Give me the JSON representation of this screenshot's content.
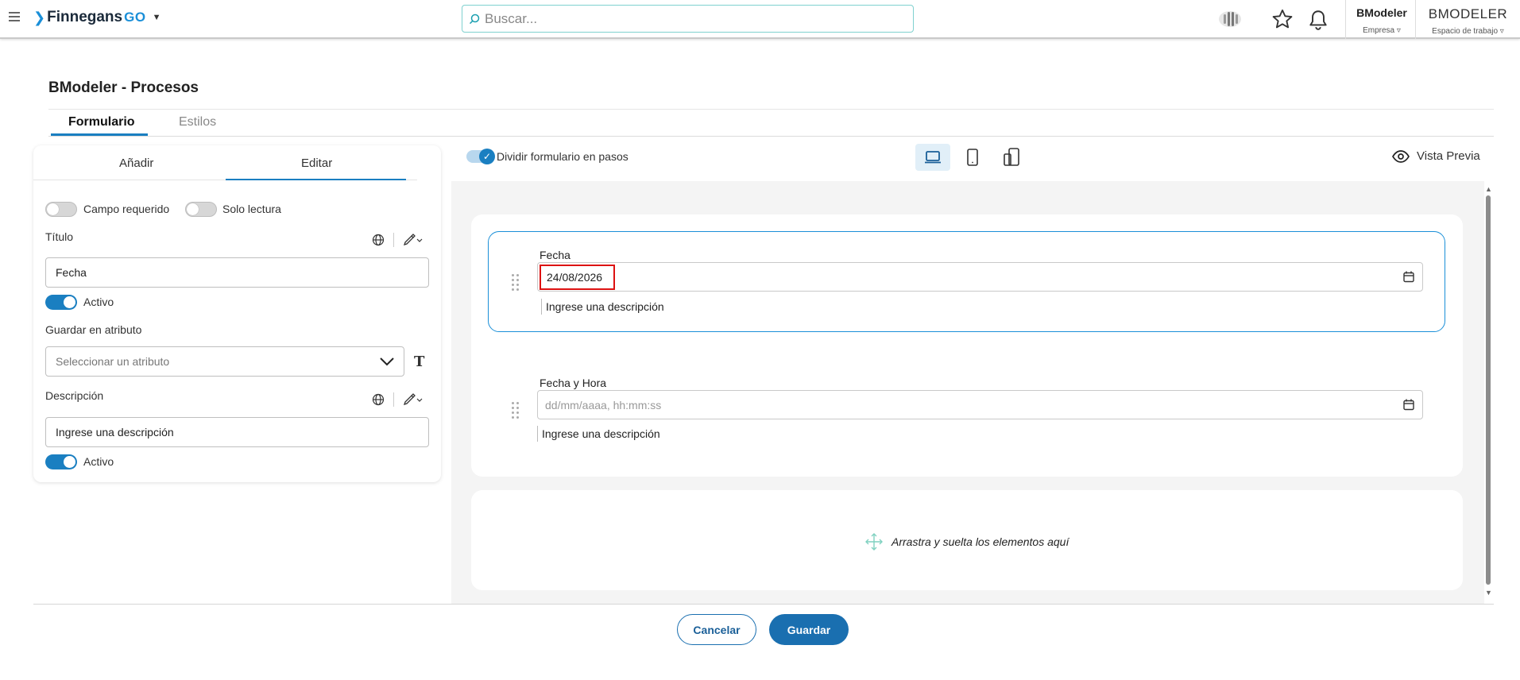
{
  "brand": {
    "name": "Finnegans",
    "suffix": "GO"
  },
  "search": {
    "placeholder": "Buscar..."
  },
  "user_menu": {
    "company_name": "BModeler",
    "company_label": "Empresa",
    "workspace_name": "BMODELER",
    "workspace_label": "Espacio de trabajo"
  },
  "page": {
    "title": "BModeler - Procesos"
  },
  "main_tabs": [
    {
      "label": "Formulario",
      "active": true
    },
    {
      "label": "Estilos",
      "active": false
    }
  ],
  "left_panel": {
    "tabs": [
      {
        "label": "Añadir",
        "active": false
      },
      {
        "label": "Editar",
        "active": true
      }
    ],
    "required_toggle": {
      "label": "Campo requerido",
      "on": false
    },
    "readonly_toggle": {
      "label": "Solo lectura",
      "on": false
    },
    "title_field": {
      "label": "Título",
      "value": "Fecha"
    },
    "title_active": {
      "label": "Activo",
      "on": true
    },
    "attribute_field": {
      "label": "Guardar en atributo",
      "placeholder": "Seleccionar un atributo"
    },
    "description_field": {
      "label": "Descripción",
      "value": "Ingrese una descripción"
    },
    "description_active": {
      "label": "Activo",
      "on": true
    }
  },
  "toolbar": {
    "split_steps": {
      "label": "Dividir formulario en pasos",
      "on": true
    },
    "preview_label": "Vista Previa"
  },
  "form_fields": [
    {
      "label": "Fecha",
      "value": "24/08/2026",
      "description": "Ingrese una descripción",
      "selected": true
    },
    {
      "label": "Fecha y Hora",
      "placeholder": "dd/mm/aaaa, hh:mm:ss",
      "description": "Ingrese una descripción",
      "selected": false
    }
  ],
  "drop_zone": {
    "text": "Arrastra y suelta los elementos aquí"
  },
  "footer": {
    "cancel_label": "Cancelar",
    "save_label": "Guardar"
  },
  "colors": {
    "accent": "#1a7fc1",
    "highlight_border": "#dd1111",
    "search_border": "#7fd1cf"
  }
}
